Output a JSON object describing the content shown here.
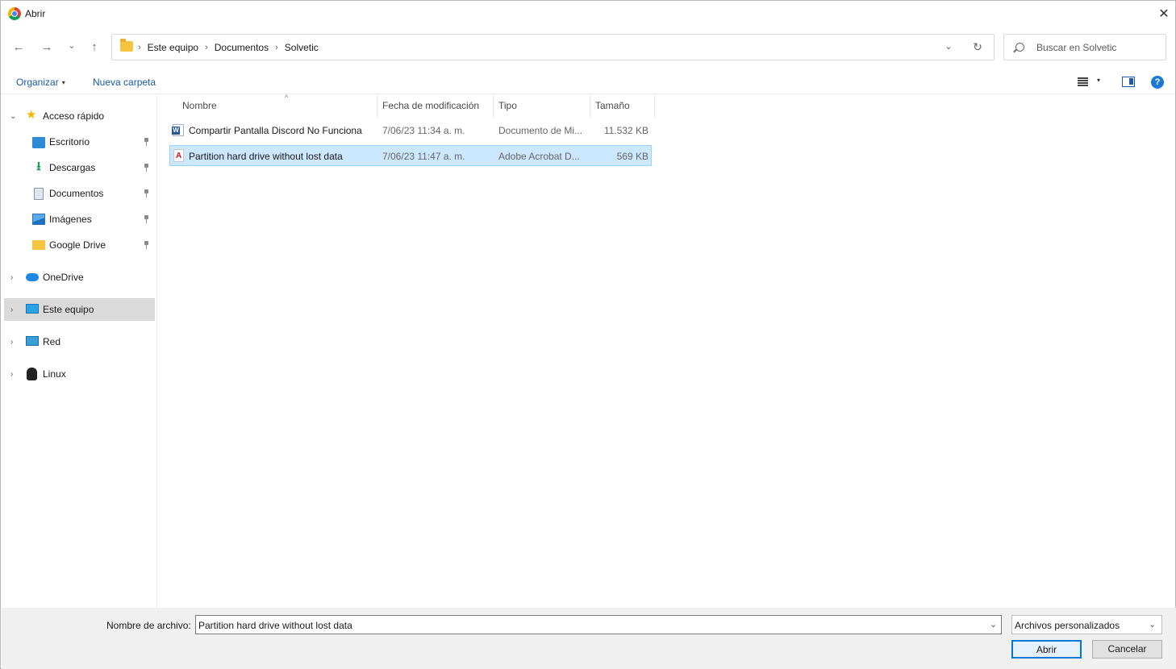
{
  "window": {
    "title": "Abrir",
    "close_glyph": "✕"
  },
  "nav": {
    "back_glyph": "←",
    "forward_glyph": "→",
    "recent_glyph": "⌄",
    "up_glyph": "↑"
  },
  "address": {
    "crumbs": [
      "Este equipo",
      "Documentos",
      "Solvetic"
    ],
    "separator": "›",
    "dropdown_glyph": "⌄",
    "refresh_glyph": "↻"
  },
  "search": {
    "placeholder": "Buscar en Solvetic"
  },
  "toolbar": {
    "organize_label": "Organizar",
    "organize_caret": "▾",
    "new_folder_label": "Nueva carpeta",
    "view_caret": "▾",
    "help_label": "?"
  },
  "sidebar": {
    "expanded_glyph": "⌄",
    "collapsed_glyph": "›",
    "quick_access": {
      "label": "Acceso rápido",
      "items": [
        {
          "label": "Escritorio",
          "icon": "desktop-icon"
        },
        {
          "label": "Descargas",
          "icon": "download-icon"
        },
        {
          "label": "Documentos",
          "icon": "documents-icon"
        },
        {
          "label": "Imágenes",
          "icon": "pictures-icon"
        },
        {
          "label": "Google Drive",
          "icon": "folder-icon"
        }
      ]
    },
    "roots": [
      {
        "label": "OneDrive",
        "icon": "cloud-icon"
      },
      {
        "label": "Este equipo",
        "icon": "computer-icon",
        "selected": true
      },
      {
        "label": "Red",
        "icon": "network-icon"
      },
      {
        "label": "Linux",
        "icon": "linux-icon"
      }
    ]
  },
  "files": {
    "columns": [
      "Nombre",
      "Fecha de modificación",
      "Tipo",
      "Tamaño"
    ],
    "sort_glyph": "^",
    "rows": [
      {
        "name": "Compartir Pantalla Discord No Funciona",
        "date": "7/06/23 11:34 a. m.",
        "type": "Documento de Mi...",
        "size": "11.532 KB",
        "icon": "word-doc-icon",
        "selected": false
      },
      {
        "name": "Partition hard drive without lost data",
        "date": "7/06/23 11:47 a. m.",
        "type": "Adobe Acrobat D...",
        "size": "569 KB",
        "icon": "pdf-icon",
        "selected": true
      }
    ]
  },
  "bottom": {
    "filename_label": "Nombre de archivo:",
    "filename_value": "Partition hard drive without lost data",
    "filename_caret": "⌄",
    "filter_value": "Archivos personalizados",
    "filter_caret": "⌄",
    "open_label": "Abrir",
    "cancel_label": "Cancelar"
  },
  "colors": {
    "accent": "#0078d7",
    "link": "#1a5aa6",
    "selection": "#cce8ff",
    "selection_border": "#99d1ff",
    "sidebar_selected": "#dadada",
    "bottom_panel": "#f0f0f0"
  }
}
